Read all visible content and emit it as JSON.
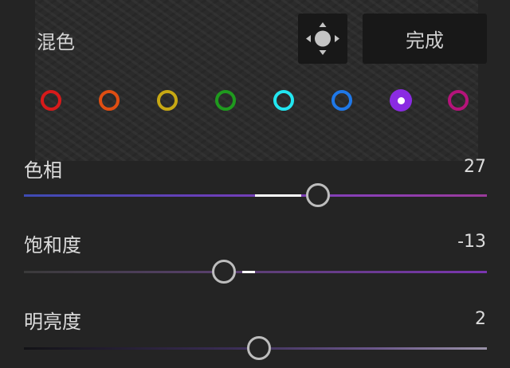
{
  "panel": {
    "title": "混色"
  },
  "buttons": {
    "done_label": "完成",
    "target_icon": "target-adjust-icon"
  },
  "colors": [
    {
      "name": "red",
      "color": "#d81a1a",
      "selected": false
    },
    {
      "name": "orange",
      "color": "#e04e12",
      "selected": false
    },
    {
      "name": "yellow",
      "color": "#c7a813",
      "selected": false
    },
    {
      "name": "green",
      "color": "#1f9a1e",
      "selected": false
    },
    {
      "name": "aqua",
      "color": "#22e6f0",
      "selected": false
    },
    {
      "name": "blue",
      "color": "#1f78e8",
      "selected": false
    },
    {
      "name": "purple",
      "color": "#8a2be2",
      "selected": true
    },
    {
      "name": "magenta",
      "color": "#b5137a",
      "selected": false
    }
  ],
  "sliders": {
    "hue": {
      "label": "色相",
      "value": "27"
    },
    "saturation": {
      "label": "饱和度",
      "value": "-13"
    },
    "luminance": {
      "label": "明亮度",
      "value": "2"
    }
  }
}
